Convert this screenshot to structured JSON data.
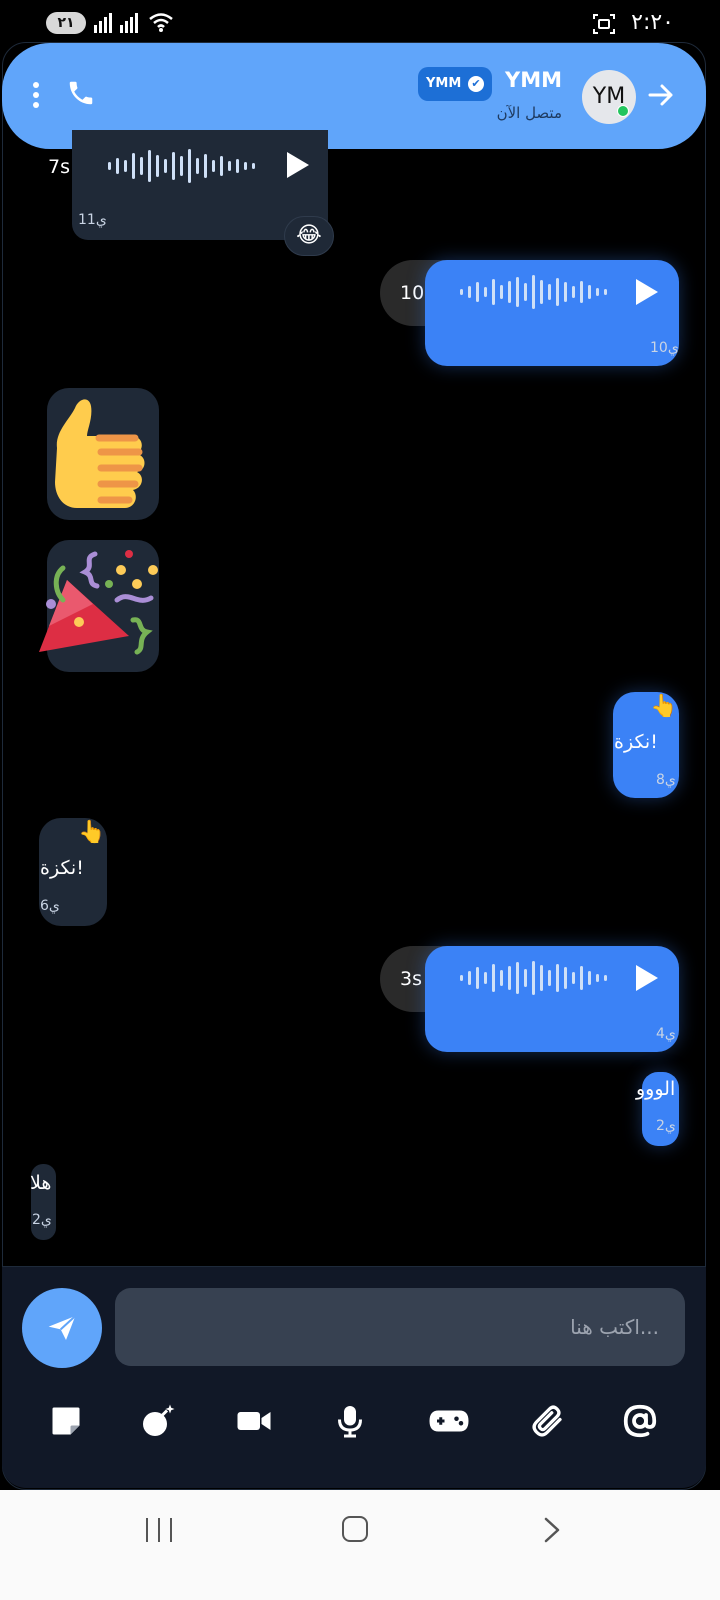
{
  "status_bar": {
    "time": "٢:٢٠",
    "battery": "٢١",
    "icons": [
      "signal-icon",
      "signal-icon",
      "wifi-icon",
      "screen-record-icon"
    ]
  },
  "header": {
    "contact_name": "YMM",
    "badge_label": "YMM",
    "status": "متصل الآن",
    "avatar_initials": "YM",
    "icons": [
      "back-arrow-icon",
      "phone-icon",
      "more-vertical-icon",
      "verified-check-icon"
    ]
  },
  "messages": [
    {
      "type": "voice",
      "direction": "in",
      "duration": "7s",
      "time": "11ي",
      "reaction": "😂"
    },
    {
      "type": "voice",
      "direction": "out",
      "duration": "10s",
      "time": "10ي"
    },
    {
      "type": "sticker",
      "direction": "in",
      "emoji": "👍"
    },
    {
      "type": "sticker",
      "direction": "in",
      "emoji": "🎉"
    },
    {
      "type": "text",
      "direction": "out",
      "text": "نكزة!",
      "icon": "👆",
      "time": "8ي"
    },
    {
      "type": "text",
      "direction": "in",
      "text": "نكزة!",
      "icon": "👆",
      "time": "6ي"
    },
    {
      "type": "voice",
      "direction": "out",
      "duration": "3s",
      "time": "4ي"
    },
    {
      "type": "text",
      "direction": "out",
      "text": "الووو",
      "time": "2ي"
    },
    {
      "type": "text",
      "direction": "in",
      "text": "هلا",
      "time": "2ي"
    }
  ],
  "composer": {
    "placeholder": "اكتب هنا...",
    "tools": [
      "sticker-icon",
      "magic-bomb-icon",
      "video-camera-icon",
      "microphone-icon",
      "gamepad-icon",
      "paperclip-icon",
      "mention-at-icon"
    ]
  },
  "colors": {
    "header_bg": "#60a5fa",
    "outgoing_bubble": "#3b82f6",
    "incoming_bubble": "#1f2937",
    "background": "#000000",
    "composer_bg": "#111827",
    "input_bg": "#374151"
  }
}
